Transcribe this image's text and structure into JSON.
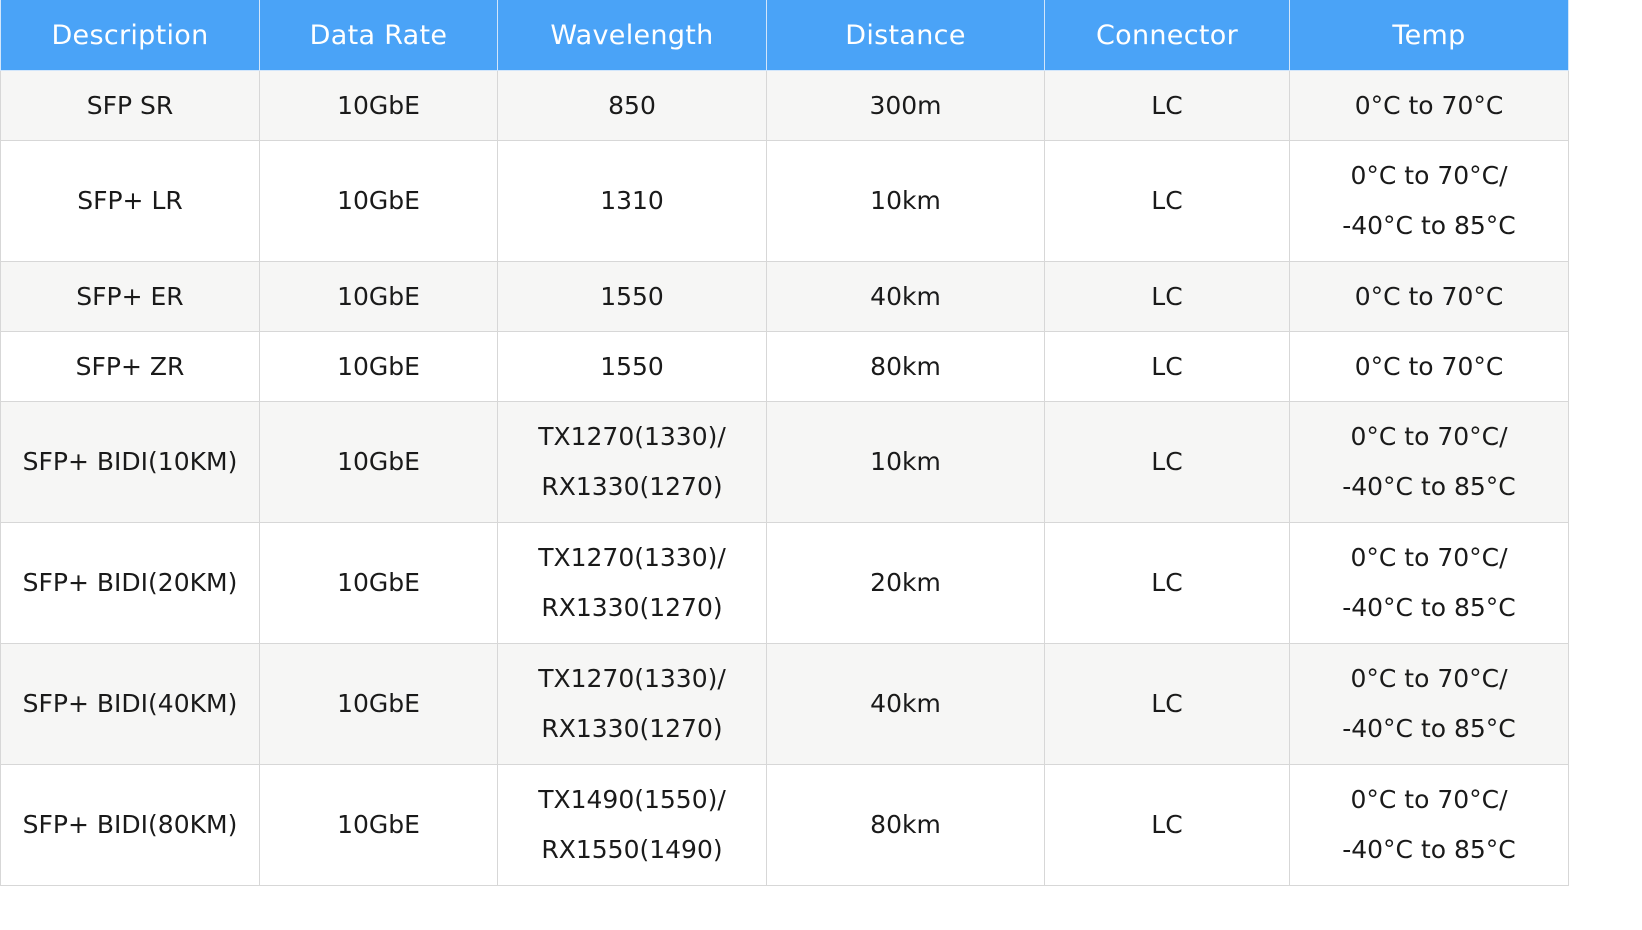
{
  "table": {
    "headers": [
      "Description",
      "Data Rate",
      "Wavelength",
      "Distance",
      "Connector",
      "Temp"
    ],
    "rows": [
      {
        "description": "SFP SR",
        "data_rate": "10GbE",
        "wavelength": [
          "850"
        ],
        "distance": "300m",
        "connector": "LC",
        "temp": [
          "0°C to 70°C"
        ]
      },
      {
        "description": "SFP+ LR",
        "data_rate": "10GbE",
        "wavelength": [
          "1310"
        ],
        "distance": "10km",
        "connector": "LC",
        "temp": [
          "0°C to 70°C/",
          "-40°C to 85°C"
        ]
      },
      {
        "description": "SFP+ ER",
        "data_rate": "10GbE",
        "wavelength": [
          "1550"
        ],
        "distance": "40km",
        "connector": "LC",
        "temp": [
          "0°C to 70°C"
        ]
      },
      {
        "description": "SFP+ ZR",
        "data_rate": "10GbE",
        "wavelength": [
          "1550"
        ],
        "distance": "80km",
        "connector": "LC",
        "temp": [
          "0°C to 70°C"
        ]
      },
      {
        "description": "SFP+ BIDI(10KM)",
        "data_rate": "10GbE",
        "wavelength": [
          "TX1270(1330)/",
          "RX1330(1270)"
        ],
        "distance": "10km",
        "connector": "LC",
        "temp": [
          "0°C to 70°C/",
          "-40°C to 85°C"
        ]
      },
      {
        "description": "SFP+ BIDI(20KM)",
        "data_rate": "10GbE",
        "wavelength": [
          "TX1270(1330)/",
          "RX1330(1270)"
        ],
        "distance": "20km",
        "connector": "LC",
        "temp": [
          "0°C to 70°C/",
          "-40°C to 85°C"
        ]
      },
      {
        "description": "SFP+ BIDI(40KM)",
        "data_rate": "10GbE",
        "wavelength": [
          "TX1270(1330)/",
          "RX1330(1270)"
        ],
        "distance": "40km",
        "connector": "LC",
        "temp": [
          "0°C to 70°C/",
          "-40°C to 85°C"
        ]
      },
      {
        "description": "SFP+ BIDI(80KM)",
        "data_rate": "10GbE",
        "wavelength": [
          "TX1490(1550)/",
          "RX1550(1490)"
        ],
        "distance": "80km",
        "connector": "LC",
        "temp": [
          "0°C to 70°C/",
          "-40°C to 85°C"
        ]
      }
    ]
  },
  "colors": {
    "header_bg": "#4aa3f7",
    "header_text": "#ffffff",
    "row_alt_bg": "#f6f6f5",
    "row_bg": "#ffffff",
    "border": "#d7d7d7"
  }
}
